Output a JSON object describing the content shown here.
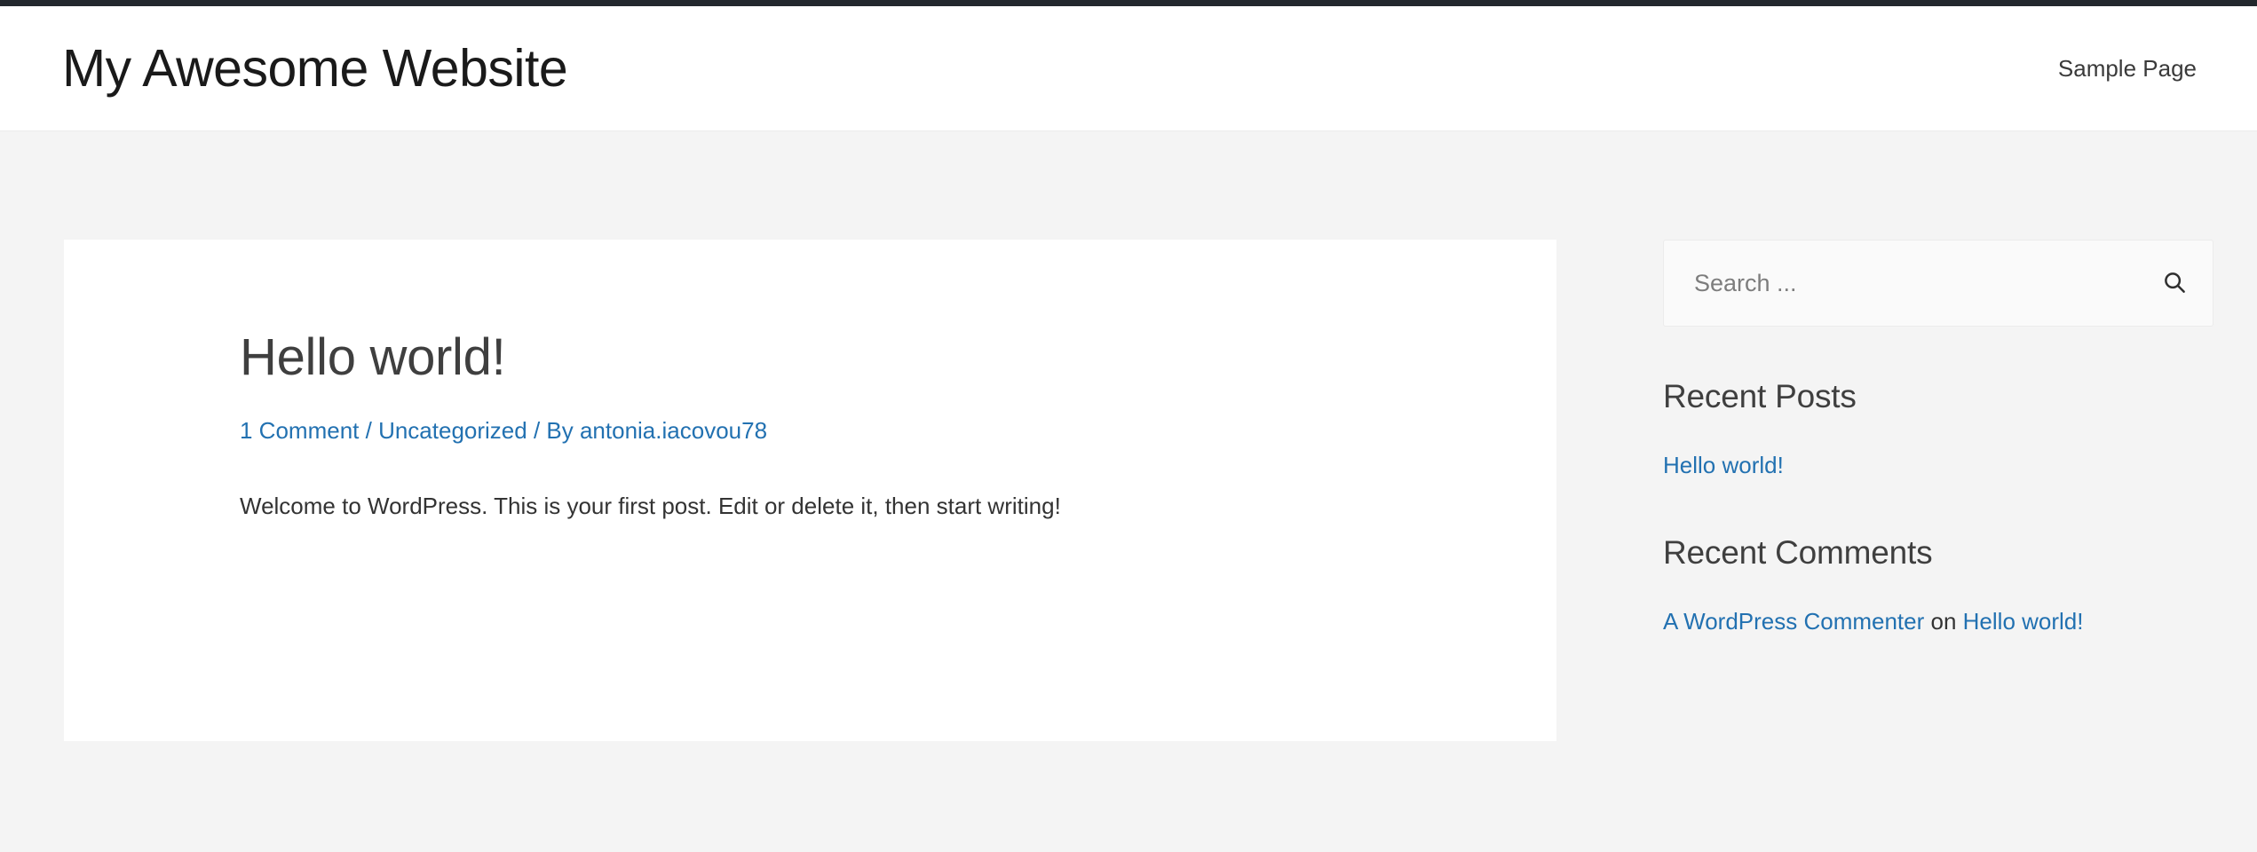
{
  "admin_bar": {
    "present": true,
    "color": "#23282d"
  },
  "header": {
    "site_title": "My Awesome Website",
    "nav": [
      {
        "label": "Sample Page"
      }
    ]
  },
  "post": {
    "title": "Hello world!",
    "meta": {
      "comments": "1 Comment",
      "separator_1": " / ",
      "category": "Uncategorized",
      "separator_2": " / ",
      "by_prefix": "By ",
      "author": "antonia.iacovou78"
    },
    "body": "Welcome to WordPress. This is your first post. Edit or delete it, then start writing!"
  },
  "sidebar": {
    "search": {
      "placeholder": "Search ...",
      "value": "",
      "icon": "search-icon"
    },
    "recent_posts": {
      "title": "Recent Posts",
      "items": [
        {
          "label": "Hello world!"
        }
      ]
    },
    "recent_comments": {
      "title": "Recent Comments",
      "items": [
        {
          "author": "A WordPress Commenter",
          "connector": " on ",
          "post": "Hello world!"
        }
      ]
    }
  },
  "colors": {
    "link": "#2271b1",
    "page_bg": "#f4f4f4",
    "card_bg": "#ffffff",
    "admin_bar": "#23282d",
    "heading": "#3f3f3f",
    "text": "#333333"
  }
}
